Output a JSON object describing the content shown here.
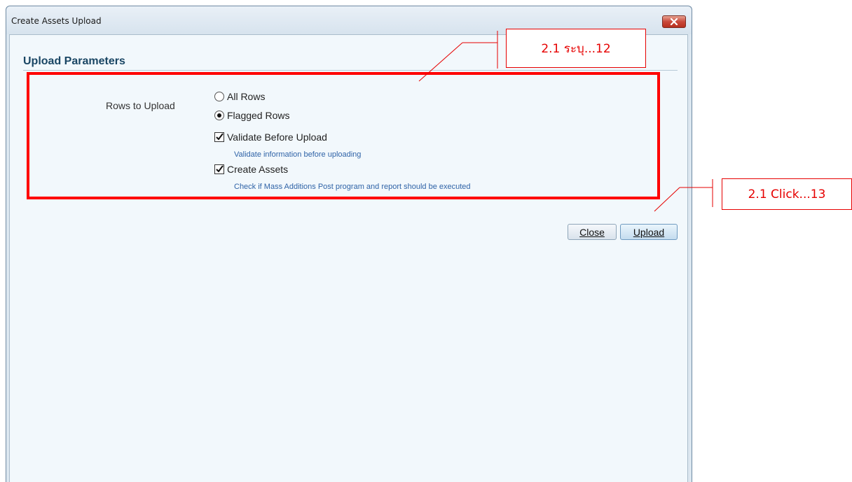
{
  "window": {
    "title": "Create Assets Upload"
  },
  "section": {
    "title": "Upload Parameters"
  },
  "form": {
    "rows_label": "Rows to Upload",
    "options": {
      "all_rows": "All Rows",
      "flagged_rows": "Flagged Rows"
    },
    "selected_option": "Flagged Rows",
    "validate": {
      "label": "Validate Before Upload",
      "checked": true,
      "hint": "Validate information before uploading"
    },
    "create_assets": {
      "label": "Create Assets",
      "checked": true,
      "hint": "Check if Mass Additions Post program and report should be executed"
    }
  },
  "buttons": {
    "close_label": "Close",
    "upload_label": "Upload"
  },
  "annotations": {
    "callout_12": "2.1 ระบุ...12",
    "callout_13": "2.1 Click...13",
    "color": "#e60000"
  }
}
